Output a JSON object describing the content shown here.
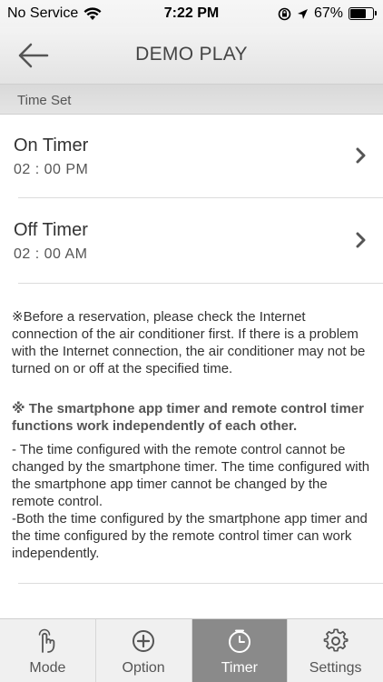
{
  "status_bar": {
    "carrier": "No Service",
    "time": "7:22 PM",
    "battery_percent": "67%",
    "battery_level": 0.67
  },
  "header": {
    "title": "DEMO PLAY"
  },
  "section": {
    "title": "Time Set"
  },
  "timers": [
    {
      "label": "On Timer",
      "time": "02 : 00 PM"
    },
    {
      "label": "Off Timer",
      "time": "02 : 00 AM"
    }
  ],
  "notes": {
    "note1": "※Before a reservation, please check the Internet connection of the air conditioner first. If there is a problem with the Internet connection, the air conditioner may not be turned on or off at the specified time.",
    "note2": "※ The smartphone app timer and remote control timer functions work independently of each other.",
    "note3": "- The time configured with the remote control cannot be changed by the smartphone timer. The time configured with the smartphone app timer cannot be changed by the remote control.\n-Both the time configured by the smartphone app timer and the time configured by the remote control timer can work independently."
  },
  "tabs": [
    {
      "label": "Mode",
      "icon": "touch-hand-icon",
      "active": false
    },
    {
      "label": "Option",
      "icon": "plus-circle-icon",
      "active": false
    },
    {
      "label": "Timer",
      "icon": "clock-icon",
      "active": true
    },
    {
      "label": "Settings",
      "icon": "gear-icon",
      "active": false
    }
  ]
}
